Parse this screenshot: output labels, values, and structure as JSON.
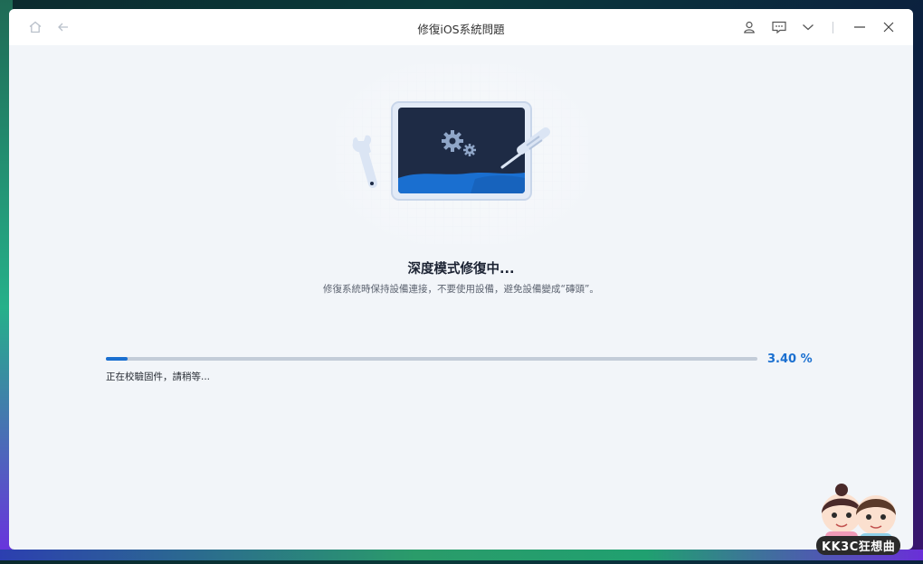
{
  "window": {
    "title": "修復iOS系統問題"
  },
  "titlebar": {
    "icons": [
      "home-icon",
      "back-arrow-icon",
      "user-icon",
      "feedback-icon",
      "chevron-down-icon",
      "minimize-icon",
      "close-icon"
    ]
  },
  "main": {
    "headline": "深度模式修復中...",
    "subline": "修復系統時保持設備連接，不要使用設備，避免設備變成“磚頭”。"
  },
  "progress": {
    "percent": 3.4,
    "percent_label": "3.40 %",
    "status": "正在校驗固件，請稍等..."
  },
  "watermark": {
    "text": "KK3C狂想曲"
  },
  "colors": {
    "accent": "#1a6fd0",
    "screen": "#1e2b45",
    "background": "#f2f5f9"
  }
}
